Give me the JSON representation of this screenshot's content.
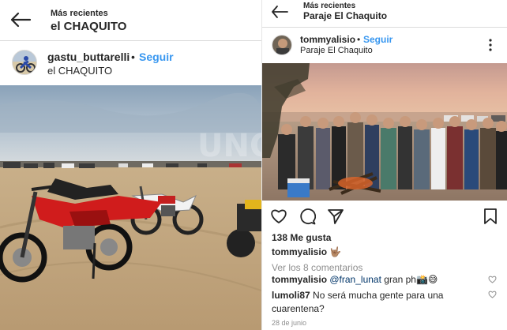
{
  "left": {
    "topbar": {
      "subtitle": "Más recientes",
      "title": "el CHAQUITO"
    },
    "post": {
      "username": "gastu_buttarelli",
      "dot": "•",
      "follow": "Seguir",
      "location": "el CHAQUITO",
      "watermark": "UNO"
    }
  },
  "right": {
    "topbar": {
      "subtitle": "Más recientes",
      "title": "Paraje El Chaquito"
    },
    "post": {
      "username": "tommyalisio",
      "dot": "•",
      "follow": "Seguir",
      "location": "Paraje El Chaquito",
      "likes": "138 Me gusta",
      "caption_user": "tommyalisio",
      "caption_text": "🤟🏽",
      "view_comments": "Ver los 8 comentarios",
      "comments": [
        {
          "user": "tommyalisio",
          "mention": "@fran_lunat",
          "text": " gran ph📸😅"
        },
        {
          "user": "lumoli87",
          "mention": "",
          "text": " No será mucha gente para una cuarentena?"
        }
      ],
      "date": "28 de junio"
    }
  },
  "colors": {
    "link": "#3897f0",
    "text": "#262626",
    "muted": "#8e8e8e",
    "moto_red": "#d01c1c"
  },
  "icons": [
    "back-arrow-icon",
    "heart-icon",
    "comment-icon",
    "share-icon",
    "bookmark-icon",
    "more-options-icon",
    "small-heart-icon"
  ]
}
